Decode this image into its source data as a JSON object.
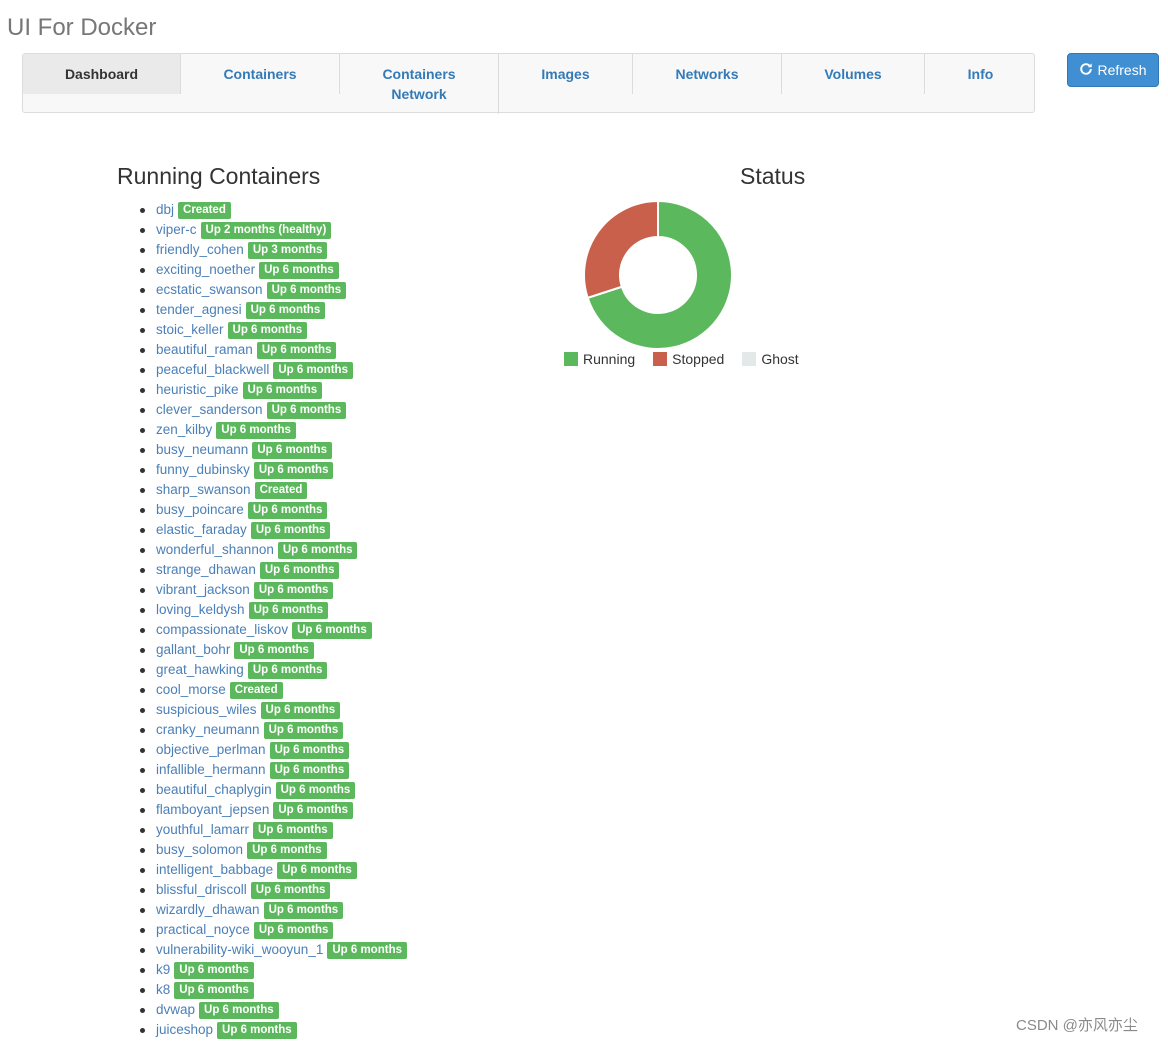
{
  "app": {
    "title": "UI For Docker"
  },
  "tabs": [
    {
      "label": "Dashboard",
      "active": true
    },
    {
      "label": "Containers",
      "active": false
    },
    {
      "label": "Containers Network",
      "active": false
    },
    {
      "label": "Images",
      "active": false
    },
    {
      "label": "Networks",
      "active": false
    },
    {
      "label": "Volumes",
      "active": false
    },
    {
      "label": "Info",
      "active": false
    }
  ],
  "toolbar": {
    "refresh_label": "Refresh",
    "refresh_icon": "refresh-icon"
  },
  "containers": {
    "title": "Running Containers",
    "items": [
      {
        "name": "dbj",
        "status": "Created"
      },
      {
        "name": "viper-c",
        "status": "Up 2 months (healthy)"
      },
      {
        "name": "friendly_cohen",
        "status": "Up 3 months"
      },
      {
        "name": "exciting_noether",
        "status": "Up 6 months"
      },
      {
        "name": "ecstatic_swanson",
        "status": "Up 6 months"
      },
      {
        "name": "tender_agnesi",
        "status": "Up 6 months"
      },
      {
        "name": "stoic_keller",
        "status": "Up 6 months"
      },
      {
        "name": "beautiful_raman",
        "status": "Up 6 months"
      },
      {
        "name": "peaceful_blackwell",
        "status": "Up 6 months"
      },
      {
        "name": "heuristic_pike",
        "status": "Up 6 months"
      },
      {
        "name": "clever_sanderson",
        "status": "Up 6 months"
      },
      {
        "name": "zen_kilby",
        "status": "Up 6 months"
      },
      {
        "name": "busy_neumann",
        "status": "Up 6 months"
      },
      {
        "name": "funny_dubinsky",
        "status": "Up 6 months"
      },
      {
        "name": "sharp_swanson",
        "status": "Created"
      },
      {
        "name": "busy_poincare",
        "status": "Up 6 months"
      },
      {
        "name": "elastic_faraday",
        "status": "Up 6 months"
      },
      {
        "name": "wonderful_shannon",
        "status": "Up 6 months"
      },
      {
        "name": "strange_dhawan",
        "status": "Up 6 months"
      },
      {
        "name": "vibrant_jackson",
        "status": "Up 6 months"
      },
      {
        "name": "loving_keldysh",
        "status": "Up 6 months"
      },
      {
        "name": "compassionate_liskov",
        "status": "Up 6 months"
      },
      {
        "name": "gallant_bohr",
        "status": "Up 6 months"
      },
      {
        "name": "great_hawking",
        "status": "Up 6 months"
      },
      {
        "name": "cool_morse",
        "status": "Created"
      },
      {
        "name": "suspicious_wiles",
        "status": "Up 6 months"
      },
      {
        "name": "cranky_neumann",
        "status": "Up 6 months"
      },
      {
        "name": "objective_perlman",
        "status": "Up 6 months"
      },
      {
        "name": "infallible_hermann",
        "status": "Up 6 months"
      },
      {
        "name": "beautiful_chaplygin",
        "status": "Up 6 months"
      },
      {
        "name": "flamboyant_jepsen",
        "status": "Up 6 months"
      },
      {
        "name": "youthful_lamarr",
        "status": "Up 6 months"
      },
      {
        "name": "busy_solomon",
        "status": "Up 6 months"
      },
      {
        "name": "intelligent_babbage",
        "status": "Up 6 months"
      },
      {
        "name": "blissful_driscoll",
        "status": "Up 6 months"
      },
      {
        "name": "wizardly_dhawan",
        "status": "Up 6 months"
      },
      {
        "name": "practical_noyce",
        "status": "Up 6 months"
      },
      {
        "name": "vulnerability-wiki_wooyun_1",
        "status": "Up 6 months"
      },
      {
        "name": "k9",
        "status": "Up 6 months"
      },
      {
        "name": "k8",
        "status": "Up 6 months"
      },
      {
        "name": "dvwap",
        "status": "Up 6 months"
      },
      {
        "name": "juiceshop",
        "status": "Up 6 months"
      }
    ]
  },
  "status": {
    "title": "Status",
    "legend": [
      {
        "label": "Running",
        "color": "#5cb85c"
      },
      {
        "label": "Stopped",
        "color": "#c9604c"
      },
      {
        "label": "Ghost",
        "color": "#e3e8e8"
      }
    ]
  },
  "chart_data": {
    "type": "pie",
    "categories": [
      "Running",
      "Stopped",
      "Ghost"
    ],
    "values": [
      70,
      30,
      0
    ],
    "colors": [
      "#5cb85c",
      "#c9604c",
      "#e3e8e8"
    ]
  },
  "colors": {
    "accent": "#3f8fd2",
    "link": "#4a7fb8",
    "badge": "#5cb85c"
  },
  "watermark": "CSDN @亦风亦尘"
}
